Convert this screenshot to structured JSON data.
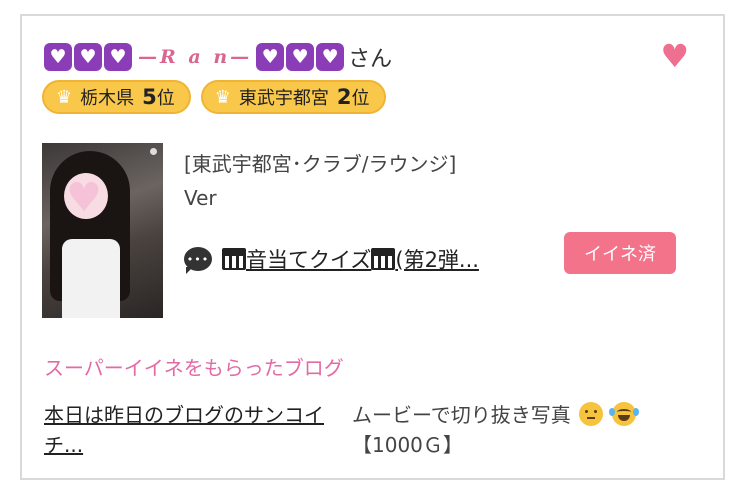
{
  "profile": {
    "name": "—R a n—",
    "honorific": "さん",
    "heart_symbol": "♥",
    "favorite_icon": "heart-icon"
  },
  "badges": [
    {
      "area": "栃木県",
      "rank": "5",
      "suffix": "位"
    },
    {
      "area": "東武宇都宮",
      "rank": "2",
      "suffix": "位"
    }
  ],
  "shop": {
    "category": "[東武宇都宮･クラブ/ラウンジ]",
    "name": "Ver"
  },
  "blog": {
    "title_start": "音当てクイズ",
    "title_end": "(第2弾...",
    "like_button": "イイネ済"
  },
  "super": {
    "label": "スーパーイイネをもらったブログ",
    "blog_title": "本日は昨日のブログのサンコイチ...",
    "blog_desc": "ムービーで切り抜き写真",
    "blog_desc2": "【1000Ｇ】"
  },
  "colors": {
    "accent_pink": "#e26ba6",
    "badge_gold": "#f9c84a",
    "like_button": "#f2738a",
    "purple_heart": "#8b3db7"
  }
}
